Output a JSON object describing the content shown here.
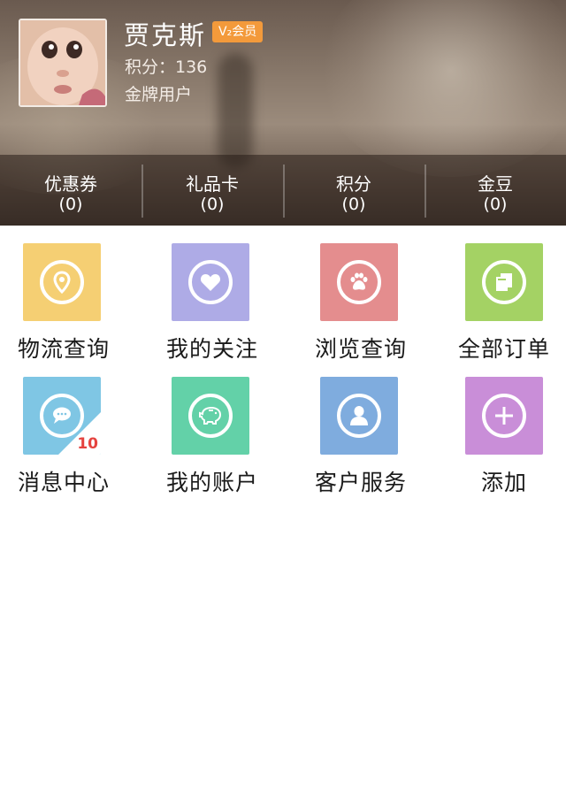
{
  "user": {
    "name": "贾克斯",
    "vip_badge": "V₂会员",
    "points_line": "积分：136",
    "level": "金牌用户"
  },
  "stats": [
    {
      "label": "优惠券",
      "count": "(0)"
    },
    {
      "label": "礼品卡",
      "count": "(0)"
    },
    {
      "label": "积分",
      "count": "(0)"
    },
    {
      "label": "金豆",
      "count": "(0)"
    }
  ],
  "grid": [
    {
      "label": "物流查询",
      "icon": "location-pin-icon",
      "color": "#f5cf73"
    },
    {
      "label": "我的关注",
      "icon": "heart-icon",
      "color": "#aeabe6"
    },
    {
      "label": "浏览查询",
      "icon": "paw-icon",
      "color": "#e48d8e"
    },
    {
      "label": "全部订单",
      "icon": "documents-icon",
      "color": "#a4d264"
    },
    {
      "label": "消息中心",
      "icon": "chat-bubble-icon",
      "color": "#7fc6e4",
      "badge": "10"
    },
    {
      "label": "我的账户",
      "icon": "piggy-bank-icon",
      "color": "#63d1a8"
    },
    {
      "label": "客户服务",
      "icon": "person-icon",
      "color": "#7facde"
    },
    {
      "label": "添加",
      "icon": "plus-icon",
      "color": "#c98ed8"
    }
  ]
}
